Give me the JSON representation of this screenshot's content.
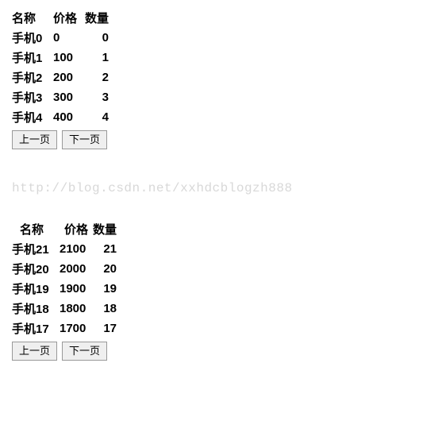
{
  "watermark": "http://blog.csdn.net/xxhdcblogzh888",
  "tables": [
    {
      "headers": {
        "name": "名称",
        "price": "价格",
        "qty": "数量"
      },
      "rows": [
        {
          "name": "手机0",
          "price": "0",
          "qty": "0"
        },
        {
          "name": "手机1",
          "price": "100",
          "qty": "1"
        },
        {
          "name": "手机2",
          "price": "200",
          "qty": "2"
        },
        {
          "name": "手机3",
          "price": "300",
          "qty": "3"
        },
        {
          "name": "手机4",
          "price": "400",
          "qty": "4"
        }
      ],
      "pager": {
        "prev": "上一页",
        "next": "下一页"
      }
    },
    {
      "headers": {
        "name": "名称",
        "price": "价格",
        "qty": "数量"
      },
      "rows": [
        {
          "name": "手机21",
          "price": "2100",
          "qty": "21"
        },
        {
          "name": "手机20",
          "price": "2000",
          "qty": "20"
        },
        {
          "name": "手机19",
          "price": "1900",
          "qty": "19"
        },
        {
          "name": "手机18",
          "price": "1800",
          "qty": "18"
        },
        {
          "name": "手机17",
          "price": "1700",
          "qty": "17"
        }
      ],
      "pager": {
        "prev": "上一页",
        "next": "下一页"
      }
    }
  ]
}
